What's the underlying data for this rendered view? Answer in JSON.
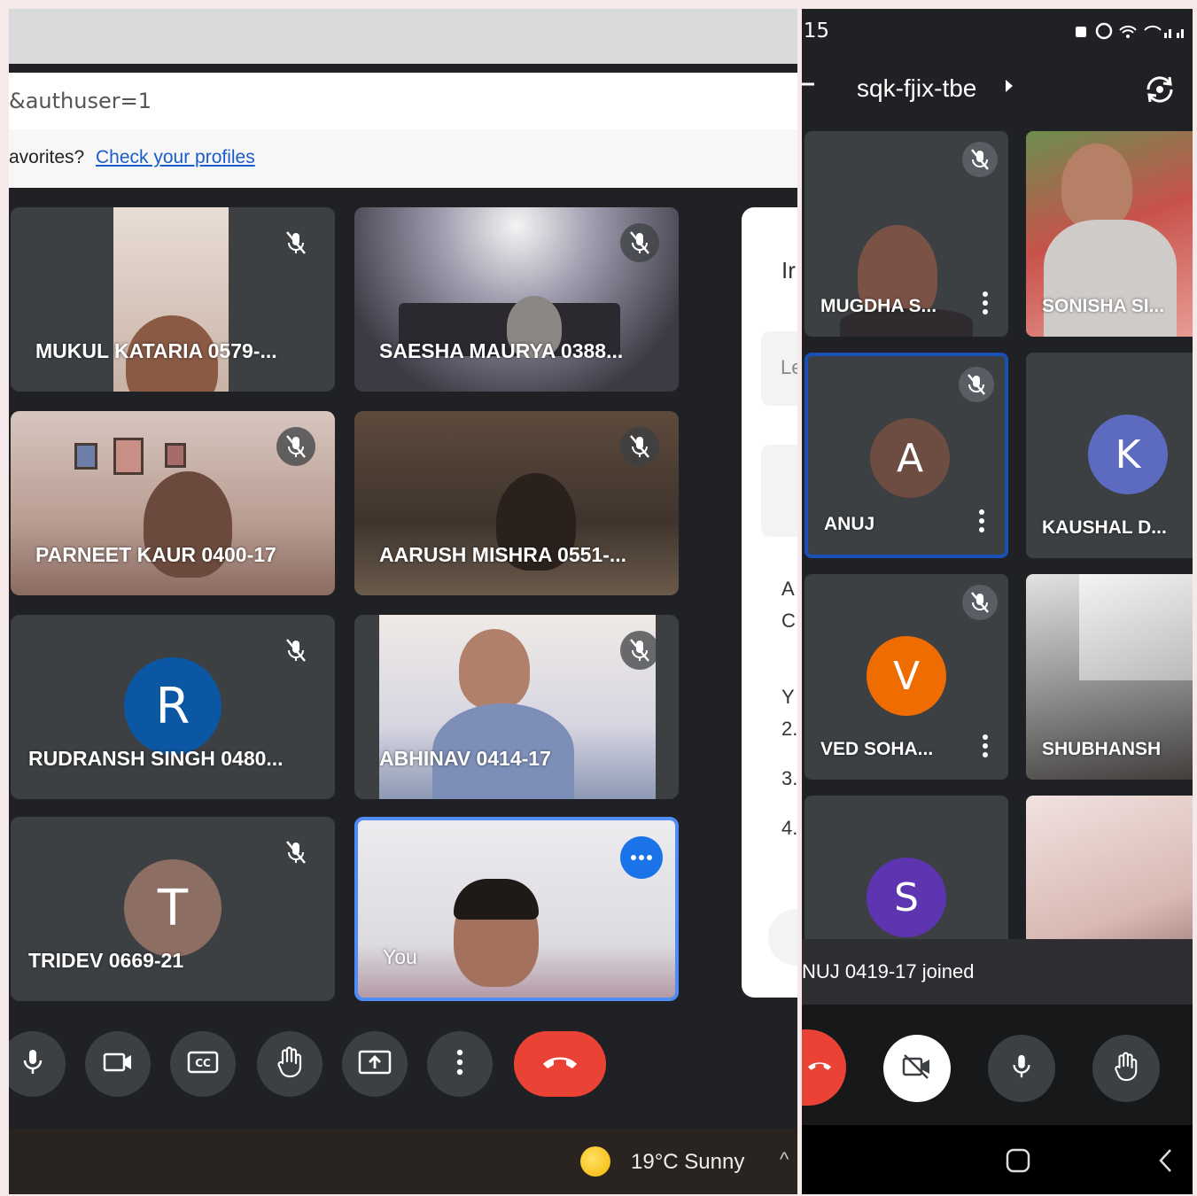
{
  "desktop": {
    "url_fragment": "&authuser=1",
    "favorites_prompt": "avorites?",
    "favorites_link": "Check your profiles",
    "tiles": [
      {
        "name": "MUKUL KATARIA 0579-..."
      },
      {
        "name": "SAESHA MAURYA 0388..."
      },
      {
        "name": "PARNEET KAUR 0400-17"
      },
      {
        "name": "AARUSH MISHRA 0551-..."
      },
      {
        "name": "RUDRANSH SINGH 0480...",
        "initial": "R"
      },
      {
        "name": "ABHINAV 0414-17"
      },
      {
        "name": "TRIDEV 0669-21",
        "initial": "T"
      },
      {
        "name": "You"
      }
    ],
    "side_panel_fragments": [
      "Ir",
      "Le",
      "A",
      "C",
      "Y",
      "2.",
      "3.",
      "4."
    ],
    "controls": [
      "microphone",
      "camera",
      "captions",
      "raise-hand",
      "present-screen",
      "more-options",
      "leave-call"
    ],
    "weather": "19°C  Sunny"
  },
  "mobile": {
    "time": ":15",
    "meeting_code": "sqk-fjix-tbe",
    "tiles": [
      {
        "name": "MUGDHA S..."
      },
      {
        "name": "SONISHA SI..."
      },
      {
        "name": "ANUJ",
        "initial": "A"
      },
      {
        "name": "KAUSHAL D...",
        "initial": "K"
      },
      {
        "name": "VED SOHA...",
        "initial": "V"
      },
      {
        "name": "SHUBHANSH"
      },
      {
        "name": "",
        "initial": "S"
      },
      {
        "name": ""
      }
    ],
    "toast": "NUJ 0419-17 joined"
  },
  "colors": {
    "meet_dark": "#202124",
    "tile_gray": "#3c4043",
    "hangup_red": "#ea4335",
    "accent_blue": "#1a73e8",
    "avatar_R": "#0b57a4",
    "avatar_T": "#8d6e63",
    "avatar_A": "#6d4c41",
    "avatar_K": "#5c6bc0",
    "avatar_V": "#ef6c00",
    "avatar_S": "#5e35b1"
  }
}
